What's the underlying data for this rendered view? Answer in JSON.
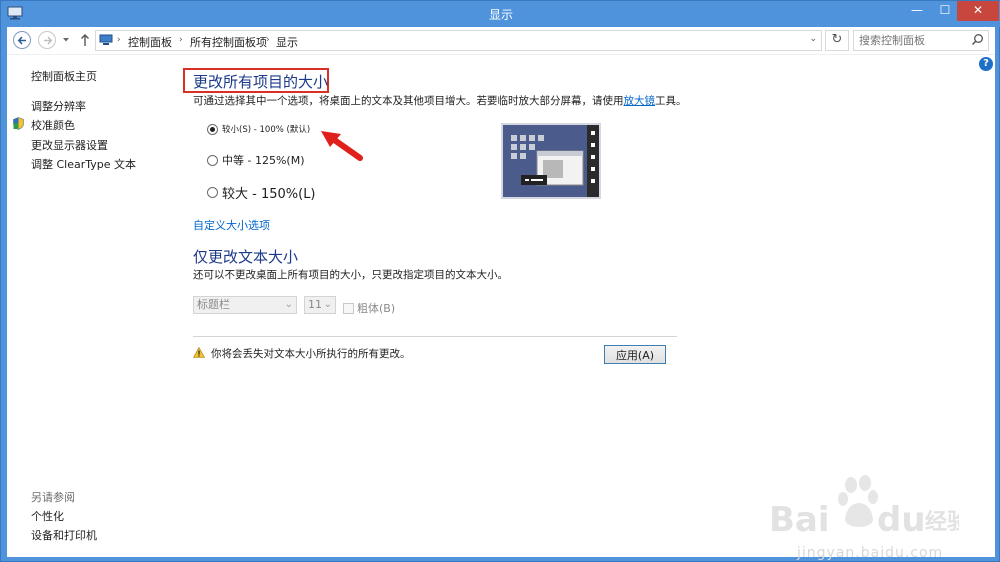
{
  "window": {
    "title": "显示",
    "minimize": "—",
    "maximize": "☐",
    "close": "✕"
  },
  "addressbar": {
    "breadcrumbs": [
      "控制面板",
      "所有控制面板项",
      "显示"
    ],
    "search_placeholder": "搜索控制面板"
  },
  "help": "?",
  "leftnav": {
    "home": "控制面板主页",
    "items": [
      "调整分辨率",
      "校准颜色",
      "更改显示器设置",
      "调整 ClearType 文本"
    ],
    "see_also_title": "另请参阅",
    "see_also": [
      "个性化",
      "设备和打印机"
    ]
  },
  "main": {
    "heading": "更改所有项目的大小",
    "description_before": "可通过选择其中一个选项，将桌面上的文本及其他项目增大。若要临时放大部分屏幕，请使用",
    "description_link": "放大镜",
    "description_after": "工具。",
    "options": [
      {
        "label": "较小(S) - 100% (默认)",
        "selected": true
      },
      {
        "label": "中等 - 125%(M)",
        "selected": false
      },
      {
        "label": "较大 - 150%(L)",
        "selected": false
      }
    ],
    "custom_link": "自定义大小选项",
    "text_heading": "仅更改文本大小",
    "text_description": "还可以不更改桌面上所有项目的大小，只更改指定项目的文本大小。",
    "item_select": "标题栏",
    "size_select": "11",
    "bold_label": "粗体(B)",
    "warning": "你将会丢失对文本大小所执行的所有更改。",
    "apply": "应用(A)"
  },
  "watermark": {
    "brand": "Bai du 经验",
    "url": "jingyan.baidu.com"
  },
  "colors": {
    "frame": "#4f93dc",
    "heading": "#1c3a8a",
    "link": "#0066cc",
    "highlight": "#d93025"
  }
}
